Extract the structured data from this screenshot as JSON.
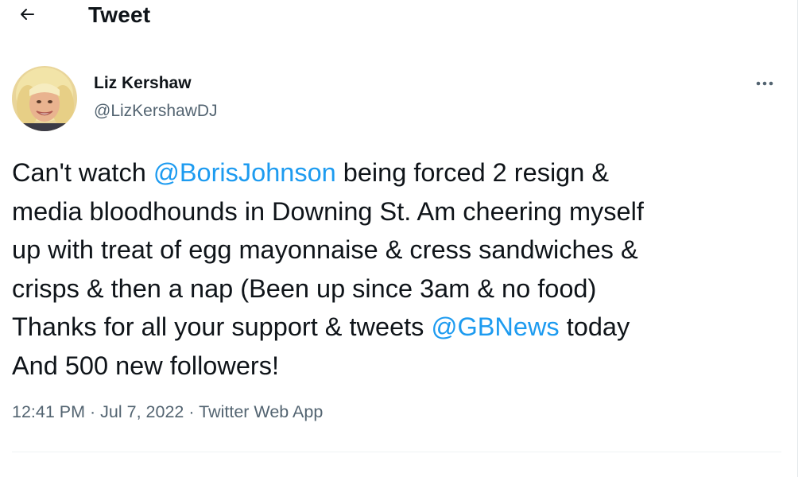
{
  "header": {
    "title": "Tweet",
    "back_icon": "arrow-left-icon"
  },
  "author": {
    "display_name": "Liz Kershaw",
    "handle": "@LizKershawDJ",
    "avatar": "profile-photo"
  },
  "more_icon": "more-horizontal-icon",
  "tweet": {
    "lines": [
      [
        {
          "text": "Can't watch "
        },
        {
          "text": "@BorisJohnson",
          "mention": true
        },
        {
          "text": " being forced 2 resign &"
        }
      ],
      [
        {
          "text": "media bloodhounds in Downing St. Am cheering myself"
        }
      ],
      [
        {
          "text": "up with treat of egg mayonnaise & cress sandwiches &"
        }
      ],
      [
        {
          "text": "crisps & then a nap (Been up since 3am & no food)"
        }
      ],
      [
        {
          "text": "Thanks for all your support & tweets "
        },
        {
          "text": "@GBNews",
          "mention": true
        },
        {
          "text": " today"
        }
      ],
      [
        {
          "text": "And 500 new followers!"
        }
      ]
    ]
  },
  "meta": {
    "time": "12:41 PM",
    "separator": "·",
    "date": "Jul 7, 2022",
    "source": "Twitter Web App"
  },
  "colors": {
    "link": "#1d9bf0",
    "secondary_text": "#536471",
    "primary_text": "#0f1419"
  }
}
